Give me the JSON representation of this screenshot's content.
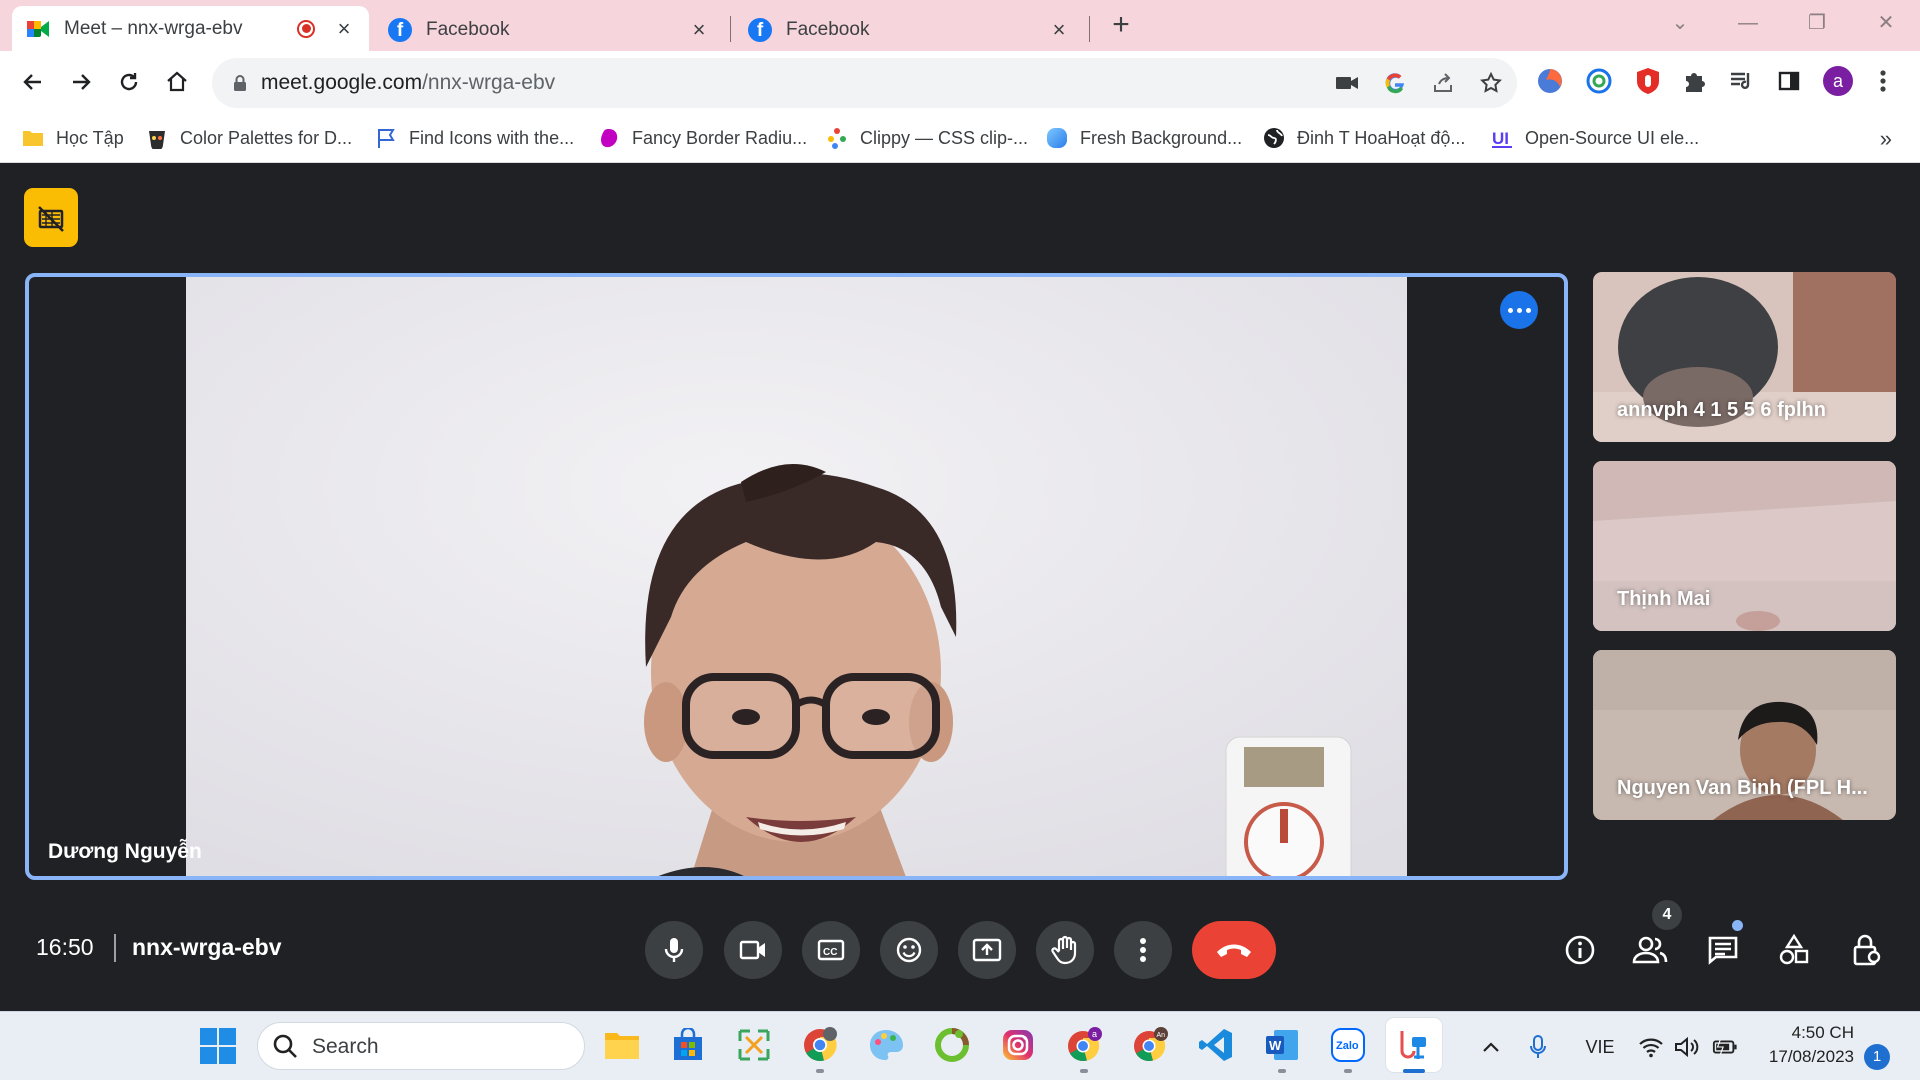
{
  "browser": {
    "tabs": [
      {
        "title": "Meet – nnx-wrga-ebv",
        "active": true,
        "recording": true
      },
      {
        "title": "Facebook",
        "active": false
      },
      {
        "title": "Facebook",
        "active": false
      }
    ],
    "url_host": "meet.google.com",
    "url_path": "/nnx-wrga-ebv",
    "profile_initial": "a",
    "bookmarks": [
      {
        "label": "Học Tập",
        "icon": "folder-icon"
      },
      {
        "label": "Color Palettes for D...",
        "icon": "palette-site-icon"
      },
      {
        "label": "Find Icons with the...",
        "icon": "flag-icon"
      },
      {
        "label": "Fancy Border Radiu...",
        "icon": "blob-icon"
      },
      {
        "label": "Clippy — CSS clip-...",
        "icon": "clippy-icon"
      },
      {
        "label": "Fresh Background...",
        "icon": "gradient-icon"
      },
      {
        "label": "Đinh T HoaHoạt độ...",
        "icon": "globe-icon"
      },
      {
        "label": "Open-Source UI ele...",
        "icon": "ui-logo-icon"
      }
    ]
  },
  "meet": {
    "main_participant": "Dương Nguyễn",
    "participants": [
      {
        "name": "annvph 4 1 5 5 6 fplhn"
      },
      {
        "name": "Thịnh Mai"
      },
      {
        "name": "Nguyen Van Binh (FPL H..."
      }
    ],
    "time": "16:50",
    "meeting_code": "nnx-wrga-ebv",
    "people_count": "4",
    "colors": {
      "accent": "#8ab4f8",
      "end_call": "#ea4335",
      "recording": "#fbbc04",
      "background": "#202124"
    }
  },
  "taskbar": {
    "search_label": "Search",
    "language": "VIE",
    "time": "4:50 CH",
    "date": "17/08/2023",
    "notification_count": "1",
    "chrome_profile_badge": "a",
    "chrome_profile_badge2": "An",
    "zalo_label": "Zalo"
  }
}
